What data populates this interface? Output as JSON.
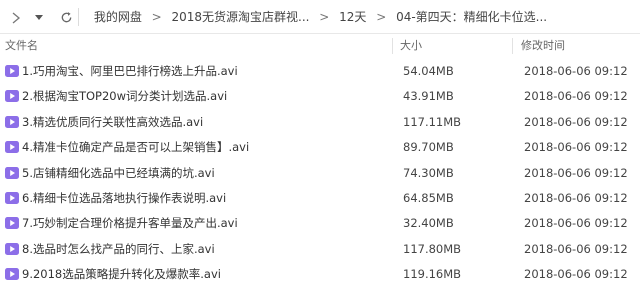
{
  "toolbar": {
    "forward_icon": "chevron-right-icon",
    "dropdown_icon": "caret-down-icon",
    "refresh_icon": "refresh-icon",
    "breadcrumb": [
      "我的网盘",
      "2018无货源淘宝店群视...",
      "12天",
      "04-第四天：精细化卡位选..."
    ]
  },
  "columns": {
    "name": "文件名",
    "size": "大小",
    "modified": "修改时间"
  },
  "files": [
    {
      "name": "1.巧用淘宝、阿里巴巴排行榜选上升品.avi",
      "size": "54.04MB",
      "modified": "2018-06-06 09:12"
    },
    {
      "name": "2.根据淘宝TOP20w词分类计划选品.avi",
      "size": "43.91MB",
      "modified": "2018-06-06 09:12"
    },
    {
      "name": "3.精选优质同行关联性高效选品.avi",
      "size": "117.11MB",
      "modified": "2018-06-06 09:12"
    },
    {
      "name": "4.精准卡位确定产品是否可以上架销售】.avi",
      "size": "89.70MB",
      "modified": "2018-06-06 09:12"
    },
    {
      "name": "5.店铺精细化选品中已经填满的坑.avi",
      "size": "74.30MB",
      "modified": "2018-06-06 09:12"
    },
    {
      "name": "6.精细卡位选品落地执行操作表说明.avi",
      "size": "64.85MB",
      "modified": "2018-06-06 09:12"
    },
    {
      "name": "7.巧妙制定合理价格提升客单量及产出.avi",
      "size": "32.40MB",
      "modified": "2018-06-06 09:12"
    },
    {
      "name": "8.选品时怎么找产品的同行、上家.avi",
      "size": "117.80MB",
      "modified": "2018-06-06 09:12"
    },
    {
      "name": "9.2018选品策略提升转化及爆款率.avi",
      "size": "119.16MB",
      "modified": "2018-06-06 09:12"
    }
  ],
  "colors": {
    "video_icon": "#8c6ee8",
    "divider": "#e8e8e8"
  }
}
